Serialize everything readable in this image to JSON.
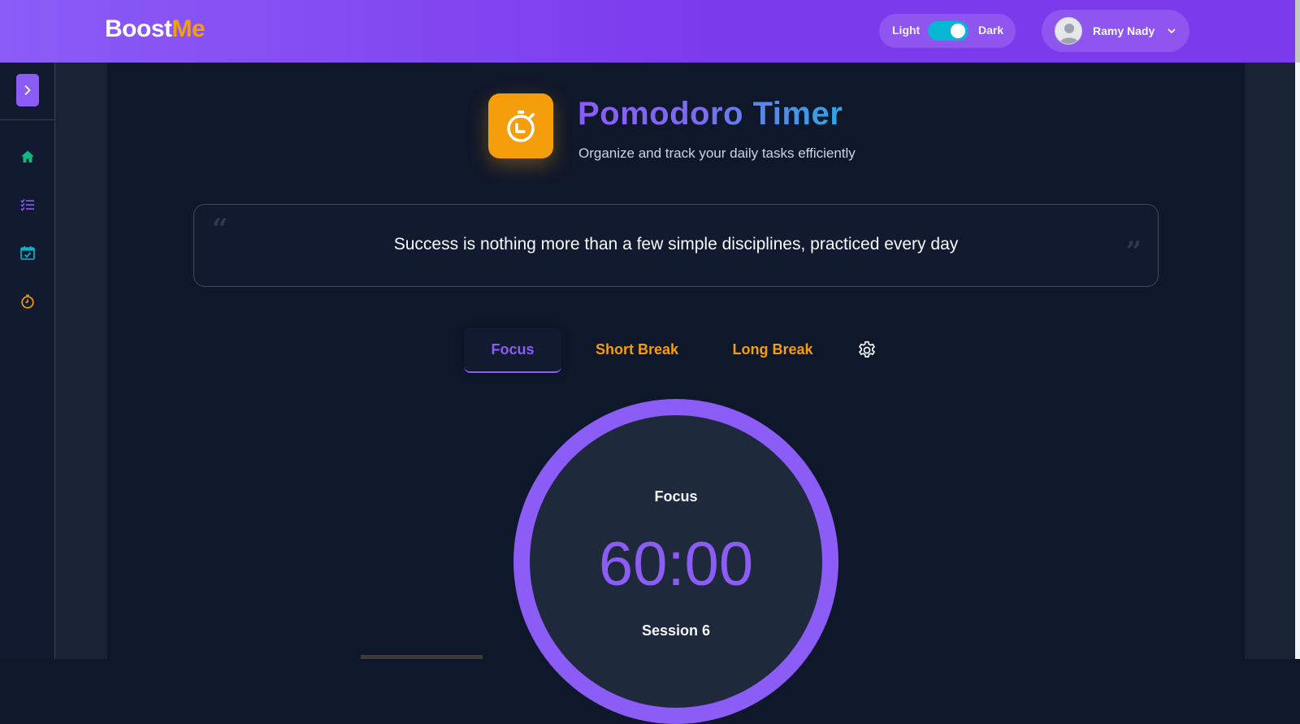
{
  "header": {
    "logo_main": "Boost",
    "logo_accent": "Me",
    "theme_toggle": {
      "light_label": "Light",
      "dark_label": "Dark",
      "state": "dark"
    },
    "user": {
      "name": "Ramy Nady"
    }
  },
  "sidebar": {
    "items": [
      {
        "name": "home",
        "icon": "home-icon",
        "color": "#10b981"
      },
      {
        "name": "tasks",
        "icon": "list-icon",
        "color": "#8b5cf6"
      },
      {
        "name": "calendar",
        "icon": "calendar-check-icon",
        "color": "#06b6d4"
      },
      {
        "name": "pomodoro",
        "icon": "timer-icon",
        "color": "#f59e0b"
      }
    ]
  },
  "main": {
    "title": "Pomodoro Timer",
    "subtitle": "Organize and track your daily tasks efficiently",
    "quote": "Success is nothing more than a few simple disciplines, practiced every day",
    "tabs": [
      {
        "label": "Focus",
        "active": true
      },
      {
        "label": "Short Break",
        "active": false
      },
      {
        "label": "Long Break",
        "active": false
      }
    ],
    "timer": {
      "mode": "Focus",
      "time": "60:00",
      "session": "Session 6"
    }
  },
  "colors": {
    "accent": "#8b5cf6",
    "secondary": "#f59e0b",
    "background": "#0f172a"
  }
}
